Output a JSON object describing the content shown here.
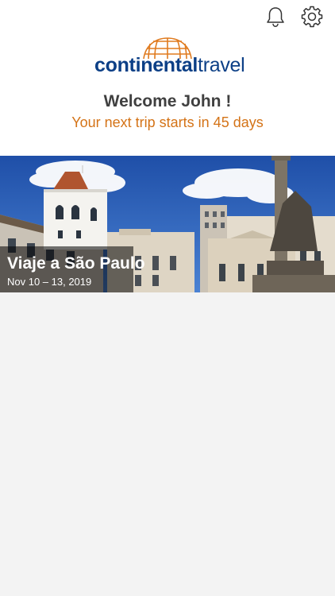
{
  "header": {
    "icons": {
      "notifications": "bell-icon",
      "settings": "gear-icon"
    },
    "logo": {
      "brand_bold": "continental",
      "brand_light": "travel",
      "color_primary": "#0c3f86",
      "color_globe": "#e07b1f"
    },
    "welcome": "Welcome John !",
    "countdown": "Your next trip starts in 45 days"
  },
  "trip": {
    "title": "Viaje a São Paulo",
    "dates": "Nov 10 – 13, 2019"
  },
  "colors": {
    "accent": "#d47317",
    "text_dark": "#404040",
    "background": "#f3f3f3"
  }
}
